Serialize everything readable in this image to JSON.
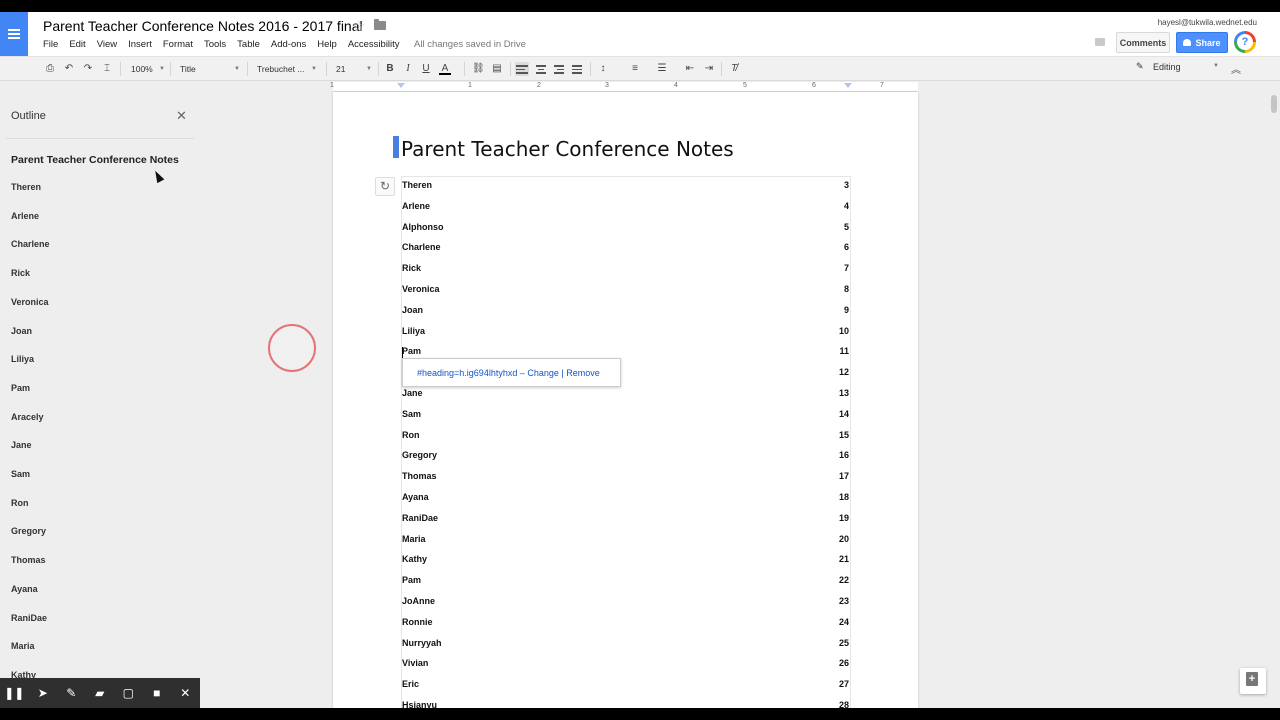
{
  "app": {
    "doc_title": "Parent Teacher Conference Notes 2016 - 2017 final",
    "user_email": "hayesl@tukwila.wednet.edu",
    "save_status": "All changes saved in Drive",
    "comments_label": "Comments",
    "share_label": "Share"
  },
  "menu": [
    "File",
    "Edit",
    "View",
    "Insert",
    "Format",
    "Tools",
    "Table",
    "Add-ons",
    "Help",
    "Accessibility"
  ],
  "toolbar": {
    "zoom": "100%",
    "style": "Title",
    "font": "Trebuchet ...",
    "font_size": "21",
    "mode": "Editing"
  },
  "ruler": [
    "1",
    "1",
    "2",
    "3",
    "4",
    "5",
    "6",
    "7"
  ],
  "outline": {
    "title": "Outline",
    "heading": "Parent Teacher Conference Notes",
    "items": [
      "Theren",
      "Arlene",
      "Charlene",
      "Rick",
      "Veronica",
      "Joan",
      "Liliya",
      "Pam",
      "Aracely",
      "Jane",
      "Sam",
      "Ron",
      "Gregory",
      "Thomas",
      "Ayana",
      "RaniDae",
      "Maria",
      "Kathy"
    ]
  },
  "document": {
    "heading": "Parent Teacher Conference Notes",
    "toc": [
      {
        "name": "Theren",
        "page": "3"
      },
      {
        "name": "Arlene",
        "page": "4"
      },
      {
        "name": "Alphonso",
        "page": "5"
      },
      {
        "name": "Charlene",
        "page": "6"
      },
      {
        "name": "Rick",
        "page": "7"
      },
      {
        "name": "Veronica",
        "page": "8"
      },
      {
        "name": "Joan",
        "page": "9"
      },
      {
        "name": "Liliya",
        "page": "10"
      },
      {
        "name": "Pam",
        "page": "11"
      },
      {
        "name": "",
        "page": "12"
      },
      {
        "name": "Jane",
        "page": "13"
      },
      {
        "name": "Sam",
        "page": "14"
      },
      {
        "name": "Ron",
        "page": "15"
      },
      {
        "name": "Gregory",
        "page": "16"
      },
      {
        "name": "Thomas",
        "page": "17"
      },
      {
        "name": "Ayana",
        "page": "18"
      },
      {
        "name": "RaniDae",
        "page": "19"
      },
      {
        "name": "Maria",
        "page": "20"
      },
      {
        "name": "Kathy",
        "page": "21"
      },
      {
        "name": "Pam",
        "page": "22"
      },
      {
        "name": "JoAnne",
        "page": "23"
      },
      {
        "name": "Ronnie",
        "page": "24"
      },
      {
        "name": "Nurryyah",
        "page": "25"
      },
      {
        "name": "Vivian",
        "page": "26"
      },
      {
        "name": "Eric",
        "page": "27"
      },
      {
        "name": "Hsianyu",
        "page": "28"
      }
    ],
    "link_bubble": "#heading=h.ig694lhtyhxd – Change | Remove"
  },
  "colors": {
    "docs_blue": "#4285f4",
    "share_blue": "#4d90fe",
    "link_blue": "#1155cc"
  }
}
